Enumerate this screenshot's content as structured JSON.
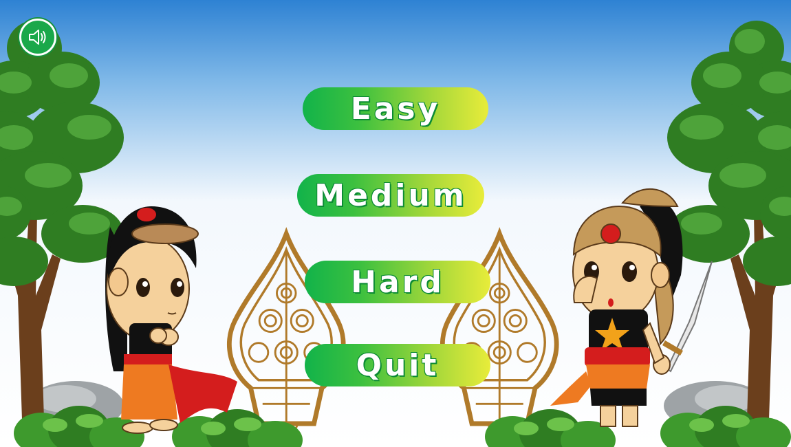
{
  "menu": {
    "easy_label": "Easy",
    "medium_label": "Medium",
    "hard_label": "Hard",
    "quit_label": "Quit"
  },
  "icons": {
    "sound": "speaker-volume-icon"
  },
  "colors": {
    "button_start": "#12b34a",
    "button_end": "#e8ec3a",
    "sky_top": "#2e82d3",
    "sky_bottom": "#ffffff",
    "tree_green": "#2f7d22",
    "gunungan_gold": "#b07a2a"
  }
}
